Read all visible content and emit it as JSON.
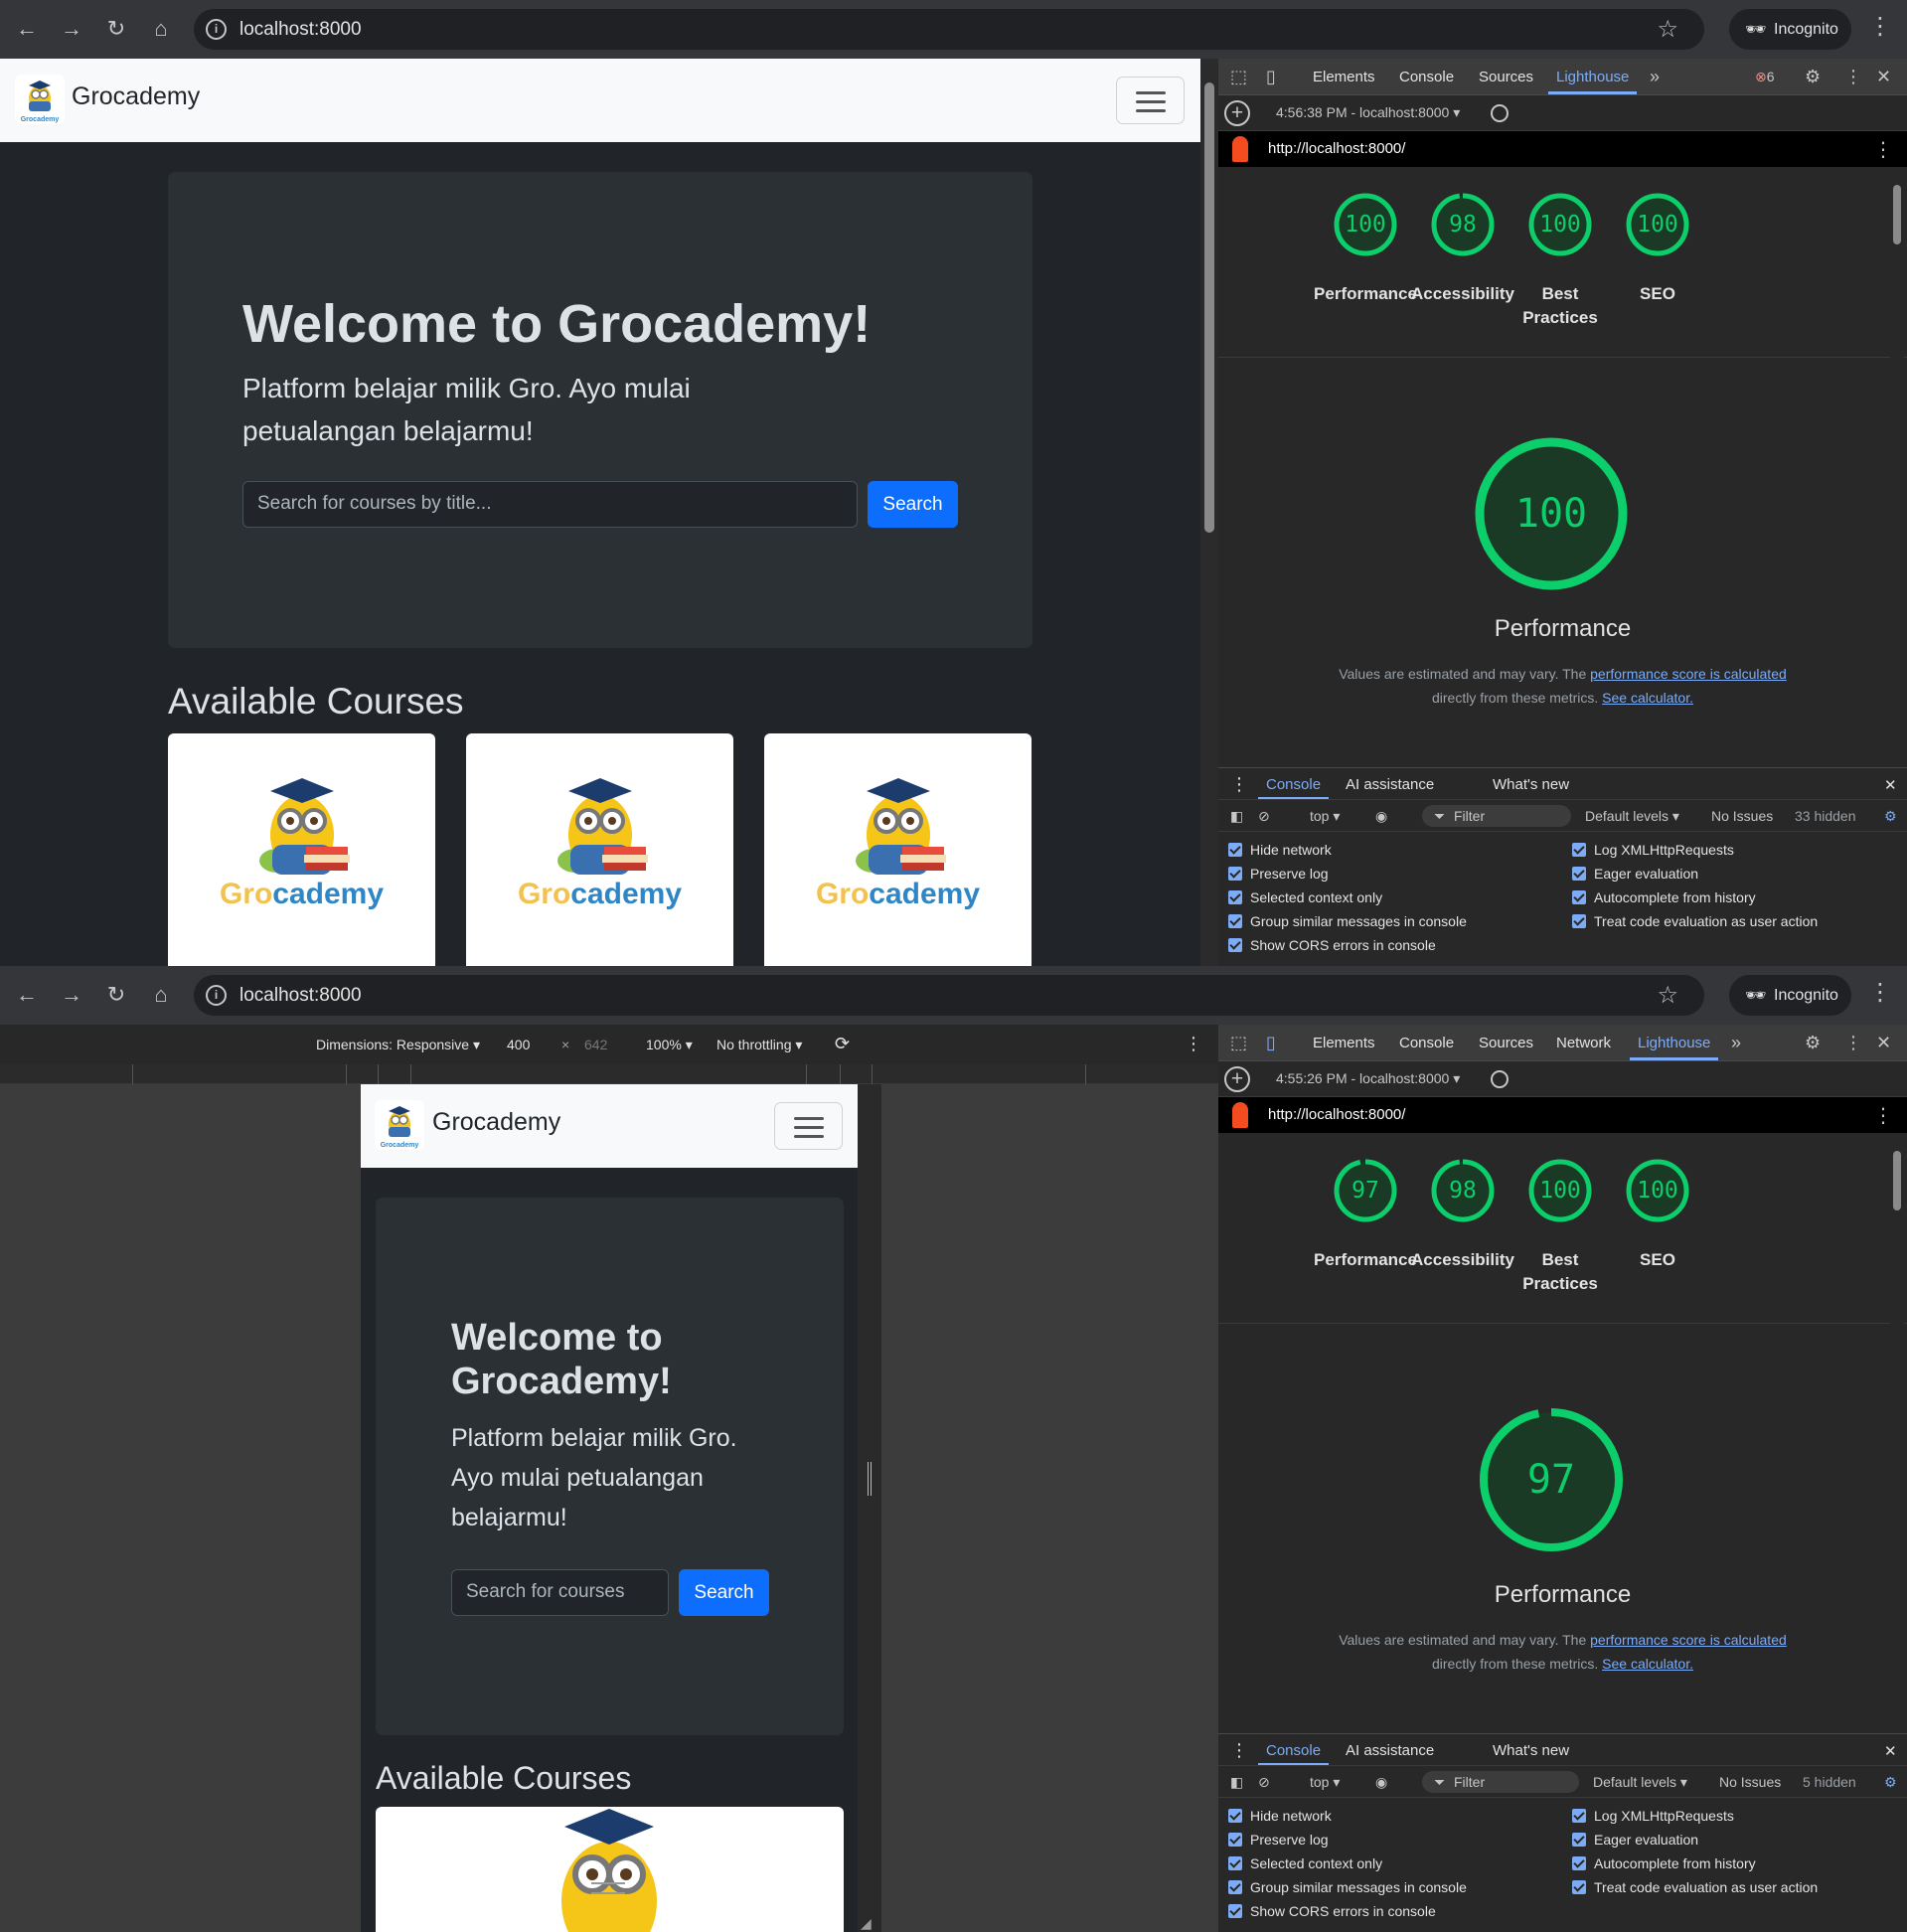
{
  "browser": {
    "url": "localhost:8000",
    "incognito_label": "Incognito"
  },
  "site": {
    "brand": "Grocademy",
    "hero_title": "Welcome to Grocademy!",
    "hero_title_mobile_line1": "Welcome to",
    "hero_title_mobile_line2": "Grocademy!",
    "hero_subtitle_line1": "Platform belajar milik Gro. Ayo mulai",
    "hero_subtitle_line2": "petualangan belajarmu!",
    "hero_subtitle_mobile_line1": "Platform belajar milik Gro.",
    "hero_subtitle_mobile_line2": "Ayo mulai petualangan",
    "hero_subtitle_mobile_line3": "belajarmu!",
    "search_placeholder": "Search for courses by title...",
    "search_placeholder_mobile": "Search for courses",
    "search_button": "Search",
    "courses_heading": "Available Courses",
    "card_logo_part1": "Gro",
    "card_logo_part2": "cademy"
  },
  "devtools_top": {
    "tabs": [
      "Elements",
      "Console",
      "Sources",
      "Lighthouse"
    ],
    "error_count": "6",
    "report_time": "4:56:38 PM - localhost:8000",
    "report_url": "http://localhost:8000/",
    "scores": [
      {
        "value": "100",
        "label": "Performance"
      },
      {
        "value": "98",
        "label": "Accessibility"
      },
      {
        "value": "100",
        "label": "Best",
        "label2": "Practices"
      },
      {
        "value": "100",
        "label": "SEO"
      }
    ],
    "big_score": "100",
    "big_label": "Performance",
    "hidden_count": "33 hidden"
  },
  "devtools_bottom": {
    "tabs": [
      "Elements",
      "Console",
      "Sources",
      "Network",
      "Lighthouse"
    ],
    "report_time": "4:55:26 PM - localhost:8000",
    "report_url": "http://localhost:8000/",
    "scores": [
      {
        "value": "97",
        "label": "Performance"
      },
      {
        "value": "98",
        "label": "Accessibility"
      },
      {
        "value": "100",
        "label": "Best",
        "label2": "Practices"
      },
      {
        "value": "100",
        "label": "SEO"
      }
    ],
    "big_score": "97",
    "big_label": "Performance",
    "hidden_count": "5 hidden"
  },
  "lighthouse_note": {
    "text1": "Values are estimated and may vary. The ",
    "link1": "performance score is calculated",
    "text2": "directly from these metrics. ",
    "link2": "See calculator."
  },
  "console": {
    "tabs": [
      "Console",
      "AI assistance",
      "What's new"
    ],
    "context": "top",
    "filter": "Filter",
    "levels": "Default levels",
    "issues": "No Issues",
    "options_left": [
      "Hide network",
      "Preserve log",
      "Selected context only",
      "Group similar messages in console",
      "Show CORS errors in console"
    ],
    "options_right": [
      "Log XMLHttpRequests",
      "Eager evaluation",
      "Autocomplete from history",
      "Treat code evaluation as user action"
    ]
  },
  "device_toolbar": {
    "dimensions": "Dimensions: Responsive",
    "width": "400",
    "height": "642",
    "zoom": "100%",
    "throttling": "No throttling"
  },
  "colors": {
    "score_green": "#0cce6b",
    "primary_button": "#0d6efd",
    "link_blue": "#7cacf8"
  }
}
